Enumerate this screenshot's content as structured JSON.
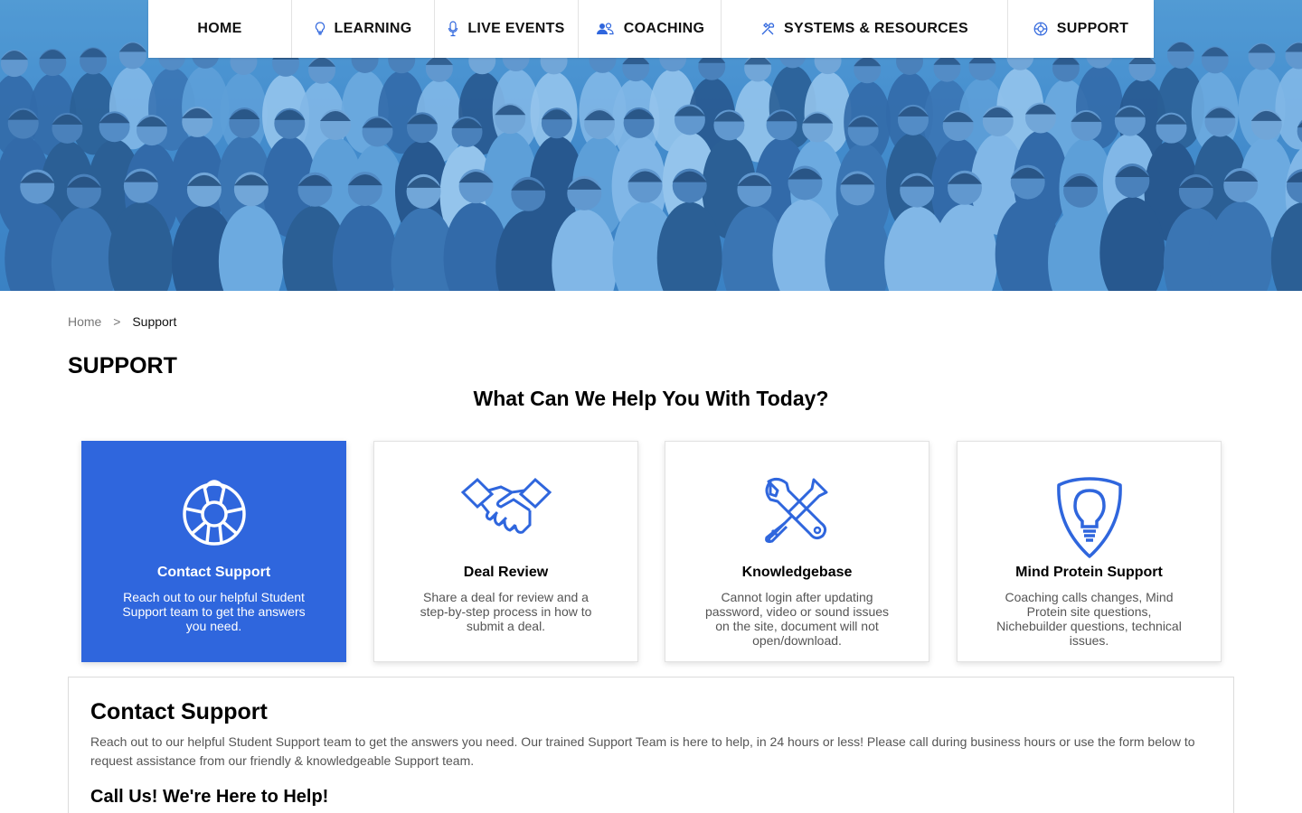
{
  "nav": {
    "items": [
      {
        "label": "HOME",
        "icon": ""
      },
      {
        "label": "LEARNING",
        "icon": "lightbulb-icon"
      },
      {
        "label": "LIVE EVENTS",
        "icon": "microphone-icon"
      },
      {
        "label": "COACHING",
        "icon": "people-icon"
      },
      {
        "label": "SYSTEMS & RESOURCES",
        "icon": "tools-icon"
      },
      {
        "label": "SUPPORT",
        "icon": "lifebuoy-icon"
      }
    ]
  },
  "hero": {
    "image": "group-photo",
    "tint": "#4a90cf"
  },
  "breadcrumb": {
    "home": "Home",
    "separator": ">",
    "current": "Support"
  },
  "page": {
    "title": "SUPPORT",
    "subtitle": "What Can We Help You With Today?"
  },
  "cards": [
    {
      "title": "Contact Support",
      "desc": "Reach out to our helpful Student Support team to get the answers you need.",
      "icon": "lifebuoy-icon",
      "active": true
    },
    {
      "title": "Deal Review",
      "desc": "Share a deal for review and a step-by-step process in how to submit a deal.",
      "icon": "handshake-icon",
      "active": false
    },
    {
      "title": "Knowledgebase",
      "desc": "Cannot login after updating password, video or sound issues on the site, document will not open/download.",
      "icon": "wrench-screwdriver-icon",
      "active": false
    },
    {
      "title": "Mind Protein Support",
      "desc": "Coaching calls changes, Mind Protein site questions, Nichebuilder questions, technical issues.",
      "icon": "shield-bulb-icon",
      "active": false
    }
  ],
  "panel": {
    "title": "Contact Support",
    "text": "Reach out to our helpful Student Support team to get the answers you need. Our trained Support Team is here to help, in 24 hours or less! Please call during business hours or use the form below to request assistance from our friendly & knowledgeable Support team.",
    "subtitle": "Call Us! We're Here to Help!"
  },
  "colors": {
    "accent": "#2f66dd",
    "icon_blue": "#2f66dd",
    "text_muted": "#555555"
  }
}
